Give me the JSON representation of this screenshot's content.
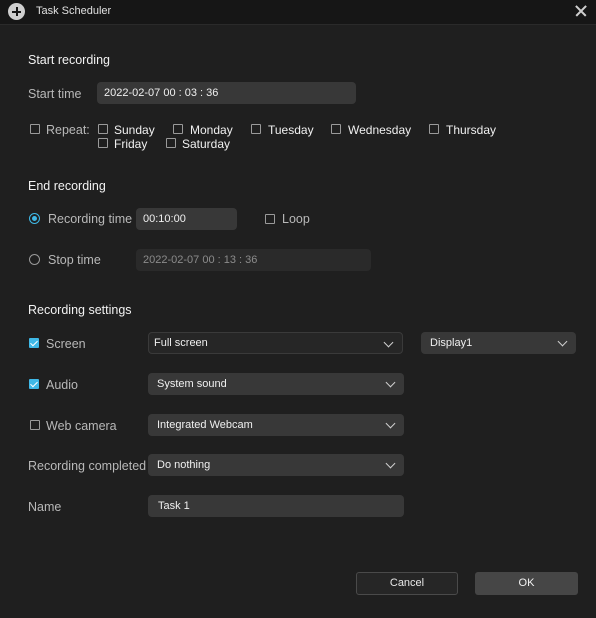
{
  "window": {
    "title": "Task Scheduler"
  },
  "start": {
    "section_title": "Start recording",
    "start_time_label": "Start time",
    "start_time_value": "2022-02-07 00 : 03 : 36",
    "repeat_label": "Repeat:",
    "days": [
      {
        "label": "Sunday",
        "checked": false
      },
      {
        "label": "Monday",
        "checked": false
      },
      {
        "label": "Tuesday",
        "checked": false
      },
      {
        "label": "Wednesday",
        "checked": false
      },
      {
        "label": "Thursday",
        "checked": false
      },
      {
        "label": "Friday",
        "checked": false
      },
      {
        "label": "Saturday",
        "checked": false
      }
    ]
  },
  "end": {
    "section_title": "End recording",
    "recording_time_label": "Recording time",
    "recording_time_value": "00:10:00",
    "loop_label": "Loop",
    "stop_time_label": "Stop time",
    "stop_time_value": "2022-02-07 00 : 13 : 36"
  },
  "settings": {
    "section_title": "Recording settings",
    "screen_label": "Screen",
    "screen_mode": "Full screen",
    "display": "Display1",
    "audio_label": "Audio",
    "audio_source": "System sound",
    "webcam_label": "Web camera",
    "webcam_source": "Integrated Webcam",
    "completed_label": "Recording completed",
    "completed_action": "Do nothing",
    "name_label": "Name",
    "name_value": "Task 1"
  },
  "buttons": {
    "cancel": "Cancel",
    "ok": "OK"
  },
  "colors": {
    "accent": "#3fb8e6",
    "background": "#1f1f1f",
    "field": "#383838"
  }
}
